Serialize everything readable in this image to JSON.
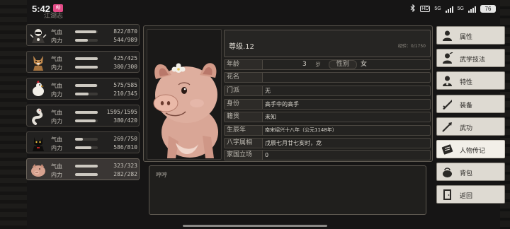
{
  "status_bar": {
    "time": "5:42",
    "notification_badge": "哔",
    "breadcrumb": "江湖志",
    "network_1": "5G",
    "network_2": "5G",
    "hd_label": "HD",
    "battery": "76"
  },
  "characters": [
    {
      "hp_label": "气血",
      "hp_value": "822/870",
      "hp_fill": 0.945,
      "mp_label": "内力",
      "mp_value": "544/989",
      "mp_fill": 0.55,
      "avatar": "dark-warrior-portrait"
    },
    {
      "hp_label": "气血",
      "hp_value": "425/425",
      "hp_fill": 1.0,
      "mp_label": "内力",
      "mp_value": "300/300",
      "mp_fill": 1.0,
      "avatar": "fox-portrait"
    },
    {
      "hp_label": "气血",
      "hp_value": "575/585",
      "hp_fill": 0.983,
      "mp_label": "内力",
      "mp_value": "210/345",
      "mp_fill": 0.609,
      "avatar": "white-bird-portrait"
    },
    {
      "hp_label": "气血",
      "hp_value": "1595/1595",
      "hp_fill": 1.0,
      "mp_label": "内力",
      "mp_value": "380/420",
      "mp_fill": 0.905,
      "avatar": "white-snake-portrait"
    },
    {
      "hp_label": "气血",
      "hp_value": "269/750",
      "hp_fill": 0.359,
      "mp_label": "内力",
      "mp_value": "586/810",
      "mp_fill": 0.723,
      "avatar": "black-cat-portrait"
    },
    {
      "hp_label": "气血",
      "hp_value": "323/323",
      "hp_fill": 1.0,
      "mp_label": "内力",
      "mp_value": "282/282",
      "mp_fill": 1.0,
      "avatar": "pig-portrait",
      "selected": true
    }
  ],
  "profile": {
    "name": "尊级.12",
    "exp": "经验：0/1750",
    "age_label": "年龄",
    "age_value": "3",
    "age_unit": "岁",
    "gender_label": "性别",
    "gender_value": "女",
    "rows": [
      {
        "label": "花名",
        "value": ""
      },
      {
        "label": "门派",
        "value": "无"
      },
      {
        "label": "身份",
        "value": "高手中的高手"
      },
      {
        "label": "籍贯",
        "value": "未知"
      },
      {
        "label": "生辰年",
        "value": "南宋绍兴十八年（公元1148年）"
      },
      {
        "label": "八字属相",
        "value": "戊辰七月廿七亥时，龙"
      },
      {
        "label": "家国立场",
        "value": "0"
      }
    ]
  },
  "bio": {
    "text": "哼哼"
  },
  "menu": [
    {
      "label": "属性",
      "icon": "attributes-icon"
    },
    {
      "label": "武学技法",
      "icon": "martial-skills-icon"
    },
    {
      "label": "特性",
      "icon": "traits-icon"
    },
    {
      "label": "装备",
      "icon": "equipment-icon"
    },
    {
      "label": "武功",
      "icon": "kungfu-icon"
    },
    {
      "label": "人物传记",
      "icon": "biography-icon",
      "active": true
    },
    {
      "label": "背包",
      "icon": "backpack-icon"
    },
    {
      "label": "返回",
      "icon": "exit-icon"
    }
  ]
}
